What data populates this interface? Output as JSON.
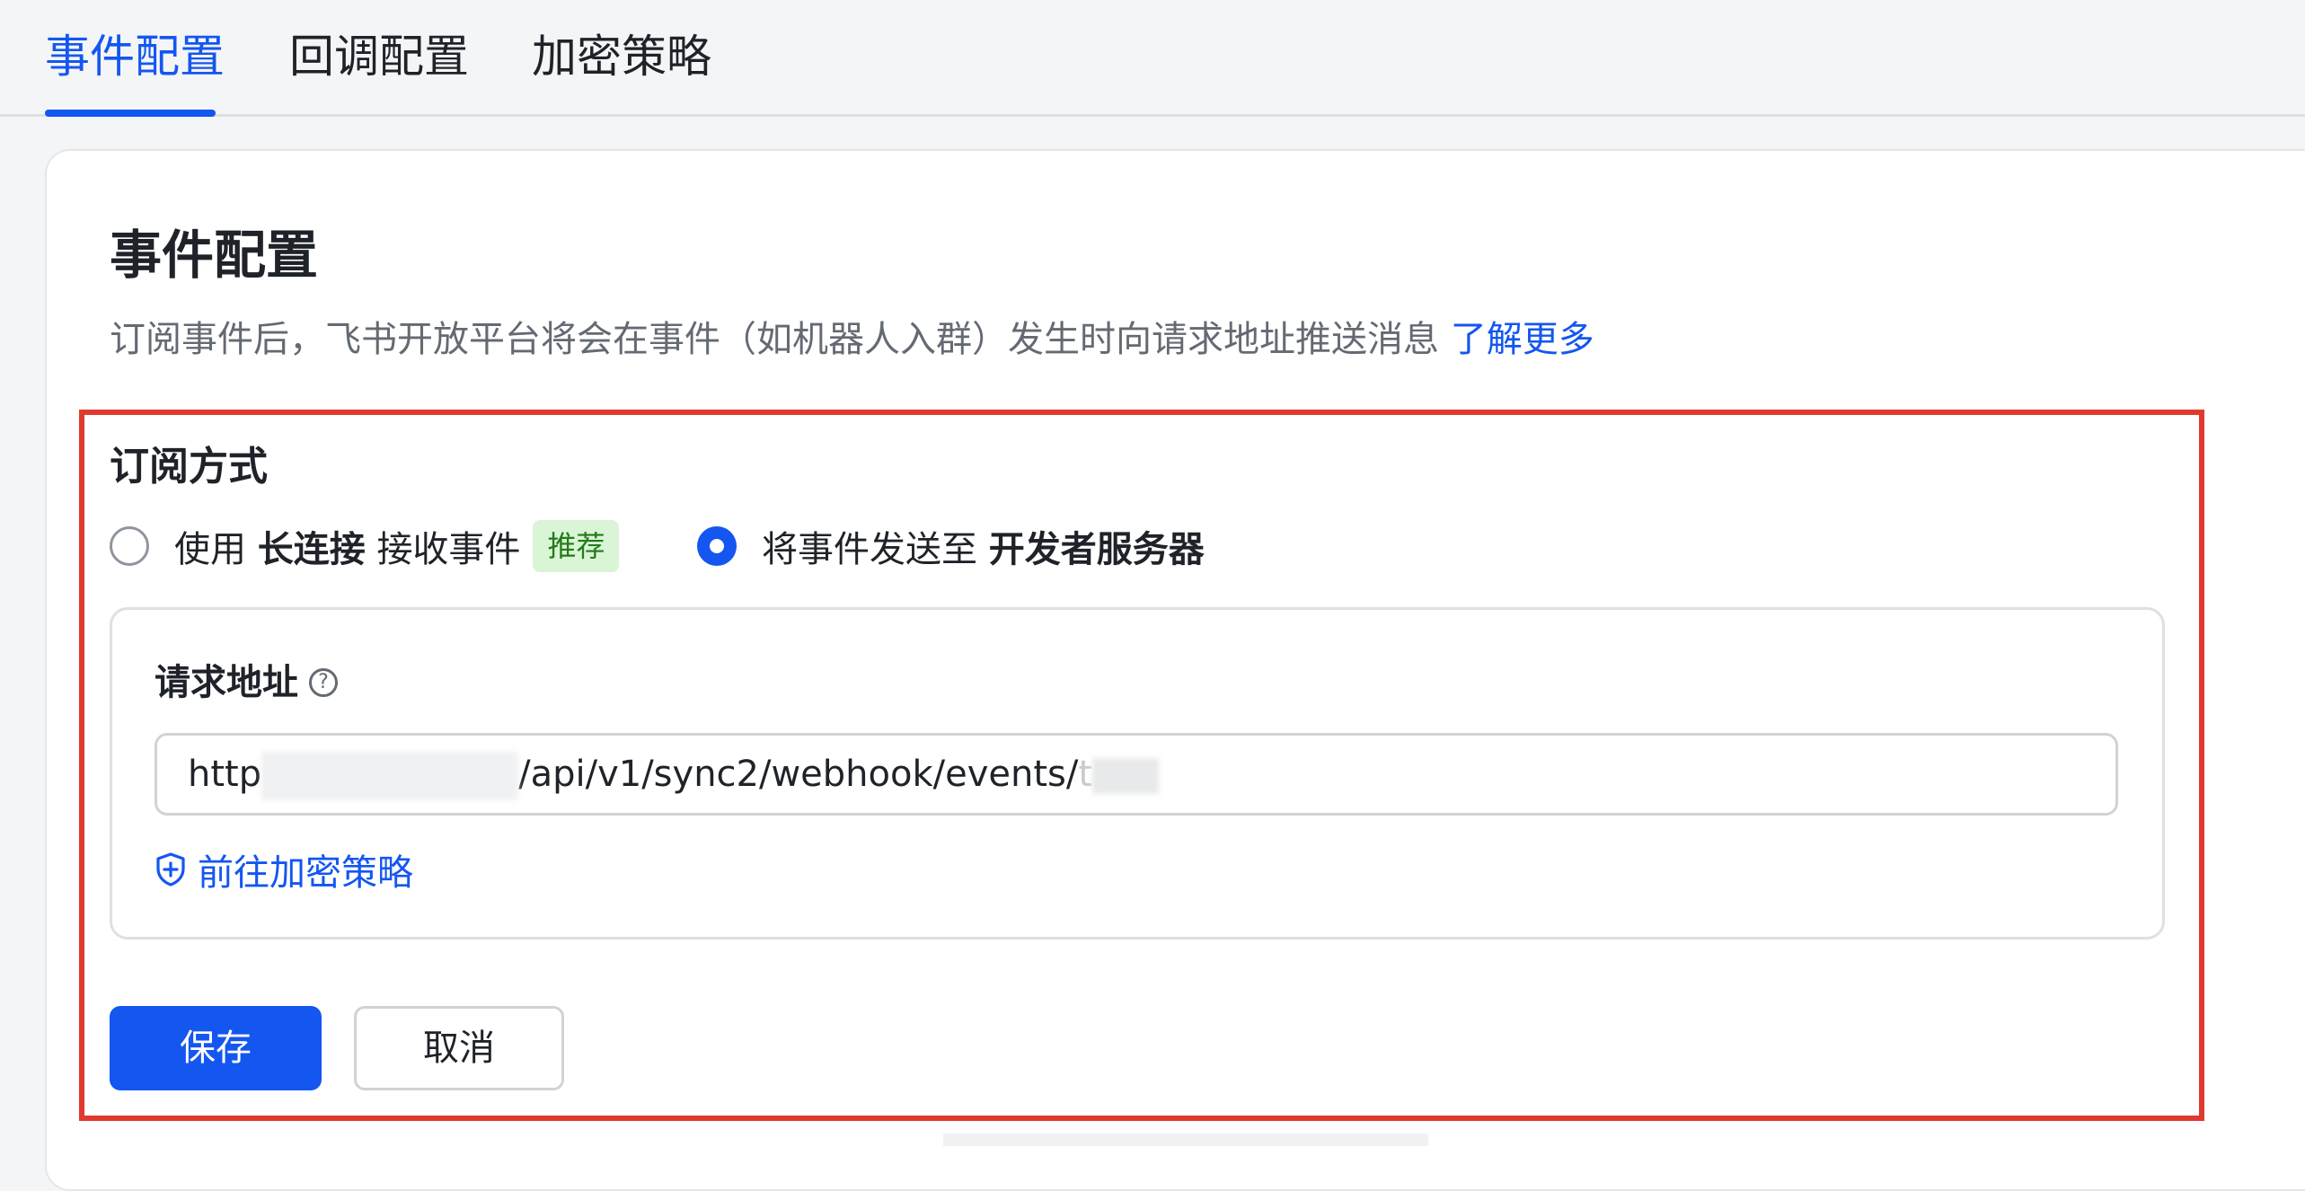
{
  "tabs": [
    {
      "label": "事件配置",
      "active": true
    },
    {
      "label": "回调配置",
      "active": false
    },
    {
      "label": "加密策略",
      "active": false
    }
  ],
  "page": {
    "title": "事件配置",
    "description": "订阅事件后，飞书开放平台将会在事件（如机器人入群）发生时向请求地址推送消息",
    "learn_more": "了解更多"
  },
  "subscription": {
    "title": "订阅方式",
    "option_long": {
      "prefix": "使用",
      "bold": "长连接",
      "suffix": "接收事件",
      "badge": "推荐",
      "checked": false
    },
    "option_server": {
      "prefix": "将事件发送至",
      "bold": "开发者服务器",
      "checked": true
    }
  },
  "request_url": {
    "label": "请求地址",
    "help_icon": "question-circle-icon",
    "value_prefix": "http",
    "value_middle": "/api/v1/sync2/webhook/events/",
    "value_tail": "t"
  },
  "encrypt_link": {
    "icon": "shield-plus-icon",
    "label": "前往加密策略"
  },
  "actions": {
    "save": "保存",
    "cancel": "取消"
  },
  "colors": {
    "accent": "#1456f0",
    "highlight": "#e0392f",
    "badge_bg": "#d9f5d6",
    "badge_text": "#237b19"
  }
}
